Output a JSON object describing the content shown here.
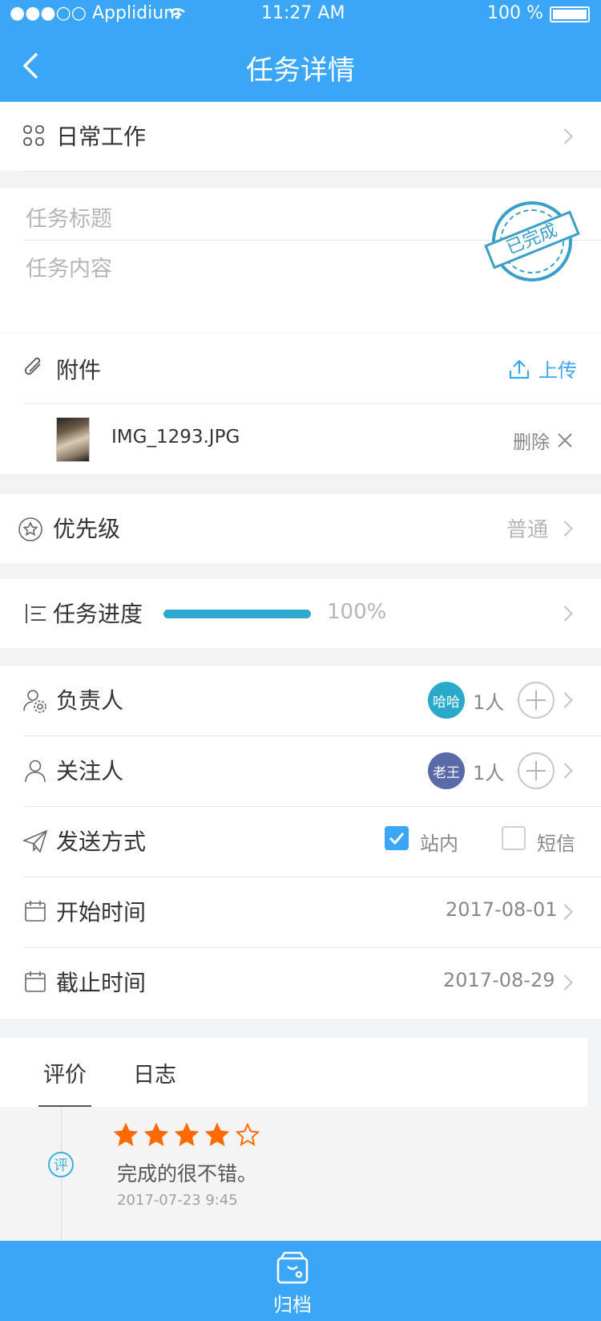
{
  "status_bar": {
    "carrier": "●●●○○ Applidium",
    "time": "11:27 AM",
    "battery": "100 %"
  },
  "nav": {
    "title": "任务详情",
    "back_icon": "back-chevron-icon"
  },
  "category": {
    "label": "日常工作",
    "icon": "grid-icon"
  },
  "task": {
    "title_placeholder": "任务标题",
    "content_placeholder": "任务内容",
    "stamp_text": "已完成"
  },
  "attachments": {
    "label": "附件",
    "upload_label": "上传",
    "file_name": "IMG_1293.JPG",
    "delete_label": "删除"
  },
  "priority": {
    "label": "优先级",
    "value": "普通"
  },
  "progress": {
    "label": "任务进度",
    "value_text": "100%",
    "value": 1.0,
    "color": "#2ea8cf"
  },
  "assignee": {
    "label": "负责人",
    "avatar_text": "哈哈",
    "avatar_color": "#2aa9c9",
    "count": "1人"
  },
  "followers": {
    "label": "关注人",
    "avatar_text": "老王",
    "avatar_color": "#5a6aa8",
    "count": "1人"
  },
  "send_method": {
    "label": "发送方式",
    "option1": "站内",
    "option1_checked": true,
    "option2": "短信",
    "option2_checked": false
  },
  "start_time": {
    "label": "开始时间",
    "value": "2017-08-01"
  },
  "end_time": {
    "label": "截止时间",
    "value": "2017-08-29"
  },
  "tabs": {
    "tab1": "评价",
    "tab2": "日志",
    "active": "评价"
  },
  "review": {
    "badge": "评",
    "rating": 4,
    "max": 5,
    "text": "完成的很不错。",
    "time": "2017-07-23 9:45",
    "star_color": "#ff6a00"
  },
  "bottom": {
    "label": "归档",
    "icon": "archive-box-icon"
  },
  "colors": {
    "brand": "#3aa6f5"
  }
}
